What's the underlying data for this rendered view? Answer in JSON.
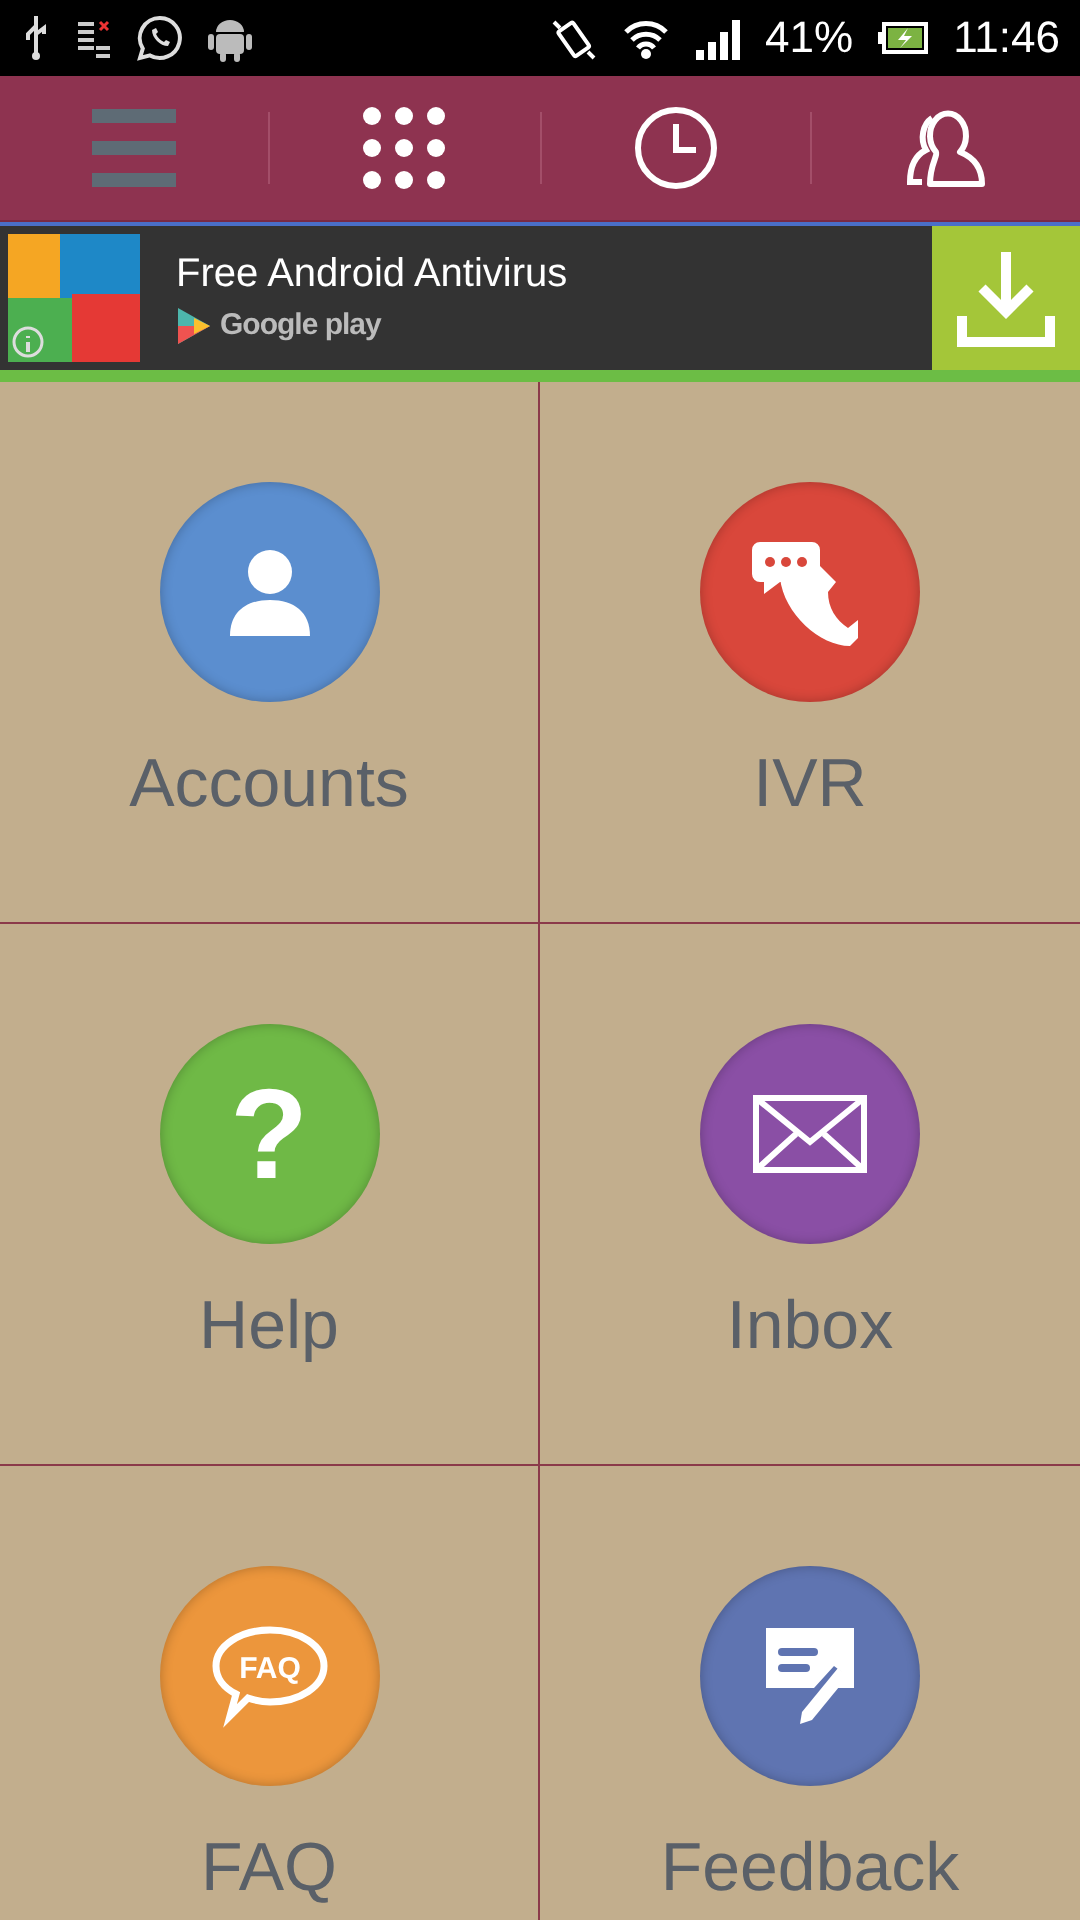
{
  "status_bar": {
    "battery": "41%",
    "time": "11:46"
  },
  "nav": [
    {
      "kind": "menu"
    },
    {
      "kind": "dialpad"
    },
    {
      "kind": "clock"
    },
    {
      "kind": "contacts"
    }
  ],
  "ad": {
    "title": "Free Android Antivirus",
    "store": "Google play"
  },
  "tiles": [
    {
      "label": "Accounts",
      "kind": "person",
      "color": "#5b8ecf"
    },
    {
      "label": "IVR",
      "kind": "call",
      "color": "#d9473b"
    },
    {
      "label": "Help",
      "kind": "help",
      "color": "#6fb946",
      "icon_text": "?"
    },
    {
      "label": "Inbox",
      "kind": "mail",
      "color": "#8a4fa5"
    },
    {
      "label": "FAQ",
      "kind": "faq",
      "color": "#ec963c",
      "icon_text": "FAQ"
    },
    {
      "label": "Feedback",
      "kind": "feedback",
      "color": "#5f74b1"
    }
  ]
}
